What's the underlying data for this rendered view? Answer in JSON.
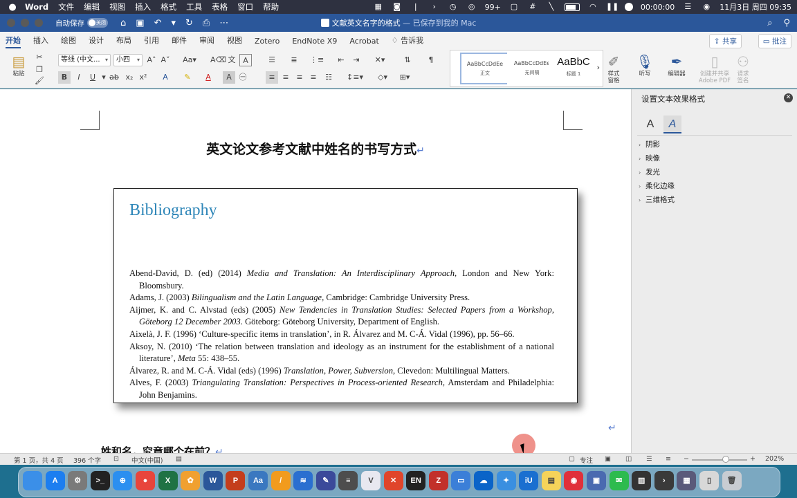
{
  "menubar": {
    "app": "Word",
    "items": [
      "文件",
      "编辑",
      "视图",
      "插入",
      "格式",
      "工具",
      "表格",
      "窗口",
      "帮助"
    ],
    "wechat_badge": "99+",
    "record_time": "00:00:00",
    "datetime": "11月3日 周四  09:35"
  },
  "titlebar": {
    "autosave_label": "自动保存",
    "autosave_state": "关闭",
    "doc_name": "文献英文名字的格式",
    "saved_status": " — 已保存到我的 Mac"
  },
  "tabs": [
    "开始",
    "插入",
    "绘图",
    "设计",
    "布局",
    "引用",
    "邮件",
    "审阅",
    "视图",
    "Zotero",
    "EndNote X9",
    "Acrobat",
    "告诉我"
  ],
  "share_label": "共享",
  "comments_label": "批注",
  "ribbon": {
    "paste_label": "粘贴",
    "font_name": "等线 (中文...",
    "font_size": "小四",
    "styles": [
      {
        "sample": "AaBbCcDdEe",
        "name": "正文"
      },
      {
        "sample": "AaBbCcDdEe",
        "name": "无间隔"
      },
      {
        "sample": "AaBbC",
        "name": "标题 1"
      }
    ],
    "style_pane_label": "样式\n窗格",
    "dictate_label": "听写",
    "editor_label": "编辑器",
    "adobe_label": "创建并共享\nAdobe PDF",
    "sign_label": "请求\n签名"
  },
  "document": {
    "title": "英文论文参考文献中姓名的书写方式",
    "figure_heading": "Bibliography",
    "references": [
      {
        "pre": "Abend-David, D. (ed) (2014) ",
        "it": "Media and Translation: An Interdisciplinary Approach",
        "post": ", London and New York: Bloomsbury."
      },
      {
        "pre": "Adams, J. (2003) ",
        "it": "Bilingualism and the Latin Language",
        "post": ", Cambridge: Cambridge University Press."
      },
      {
        "pre": "Aijmer, K. and C. Alvstad (eds) (2005) ",
        "it": "New Tendencies in Translation Studies: Selected Papers from a Workshop, Göteborg 12 December 2003",
        "post": ". Göteborg: Göteborg University, Department of English."
      },
      {
        "pre": "Aixelà, J. F. (1996) ‘Culture-specific items in translation’, in R. Álvarez and M. C-Á. Vidal (1996), pp. 56–66.",
        "it": "",
        "post": ""
      },
      {
        "pre": "Aksoy, N. (2010) ‘The relation between translation and ideology as an instrument for the establishment of a national literature’, ",
        "it": "Meta",
        "post": " 55: 438–55."
      },
      {
        "pre": "Álvarez, R. and M. C-Á. Vidal (eds) (1996) ",
        "it": "Translation, Power, Subversion",
        "post": ", Clevedon: Multilingual Matters."
      },
      {
        "pre": "Alves, F. (2003) ",
        "it": "Triangulating Translation: Perspectives in Process-oriented Research",
        "post": ", Amsterdam and Philadelphia: John Benjamins."
      }
    ],
    "heading2": "姓和名，究竟哪个在前？"
  },
  "panel": {
    "title": "设置文本效果格式",
    "tab_text_fill": "A",
    "tab_effects": "A",
    "sections": [
      "阴影",
      "映像",
      "发光",
      "柔化边缘",
      "三维格式"
    ]
  },
  "statusbar": {
    "page": "第 1 页，共 4 页",
    "words": "396 个字",
    "language": "中文(中国)",
    "focus": "专注",
    "zoom": "202%"
  },
  "dock": {
    "icons": [
      {
        "name": "finder-icon",
        "label": "",
        "color": "#3b8fe8"
      },
      {
        "name": "app-store-icon",
        "label": "A",
        "color": "#1c7ef0"
      },
      {
        "name": "system-settings-icon",
        "label": "⚙",
        "color": "#7a7a7a"
      },
      {
        "name": "terminal-icon",
        "label": ">_",
        "color": "#222222"
      },
      {
        "name": "safari-icon",
        "label": "⊕",
        "color": "#2b8ff0"
      },
      {
        "name": "chrome-icon",
        "label": "●",
        "color": "#e8453c"
      },
      {
        "name": "excel-icon",
        "label": "X",
        "color": "#1f7244"
      },
      {
        "name": "photos-icon",
        "label": "✿",
        "color": "#f0a030"
      },
      {
        "name": "word-icon",
        "label": "W",
        "color": "#2b579a"
      },
      {
        "name": "powerpoint-icon",
        "label": "P",
        "color": "#c43e1c"
      },
      {
        "name": "dictionary-icon",
        "label": "Aa",
        "color": "#3a78c0"
      },
      {
        "name": "pages-icon",
        "label": "/",
        "color": "#f29b1d"
      },
      {
        "name": "scrivener-icon",
        "label": "≋",
        "color": "#2a6fd0"
      },
      {
        "name": "pencil-app-icon",
        "label": "✎",
        "color": "#3b4a9a"
      },
      {
        "name": "notebook-icon",
        "label": "≡",
        "color": "#4d4d4d"
      },
      {
        "name": "vivaldi-icon",
        "label": "V",
        "color": "#e8e8f0"
      },
      {
        "name": "xmind-icon",
        "label": "✕",
        "color": "#e0452b"
      },
      {
        "name": "en-dict-icon",
        "label": "EN",
        "color": "#222222"
      },
      {
        "name": "zotero-icon",
        "label": "Z",
        "color": "#c2302a"
      },
      {
        "name": "tray-app-icon",
        "label": "▭",
        "color": "#3b7fd8"
      },
      {
        "name": "onedrive-icon",
        "label": "☁",
        "color": "#0a64c8"
      },
      {
        "name": "mindmap-icon",
        "label": "✦",
        "color": "#3a8fe0"
      },
      {
        "name": "iu-app-icon",
        "label": "iU",
        "color": "#1a6fd0"
      },
      {
        "name": "notes-icon",
        "label": "▤",
        "color": "#f5d35a"
      },
      {
        "name": "weibo-icon",
        "label": "◉",
        "color": "#e0303a"
      },
      {
        "name": "finder-window-icon",
        "label": "▣",
        "color": "#4a6ab0"
      },
      {
        "name": "wechat-icon",
        "label": "✉",
        "color": "#2dbb4e"
      },
      {
        "name": "piano-icon",
        "label": "▥",
        "color": "#333333"
      },
      {
        "name": "infuse-icon",
        "label": "›",
        "color": "#3a3a3a"
      },
      {
        "name": "screenshot-icon",
        "label": "▦",
        "color": "#5a5a7a"
      },
      {
        "name": "document-icon",
        "label": "▯",
        "color": "#d8d8d8"
      },
      {
        "name": "trash-icon",
        "label": "🗑",
        "color": "#c8ccd2"
      }
    ]
  },
  "colors": {
    "word_blue": "#2b579a",
    "bibliography_heading": "#2e86b8",
    "paragraph_mark": "#5b7fd1"
  }
}
